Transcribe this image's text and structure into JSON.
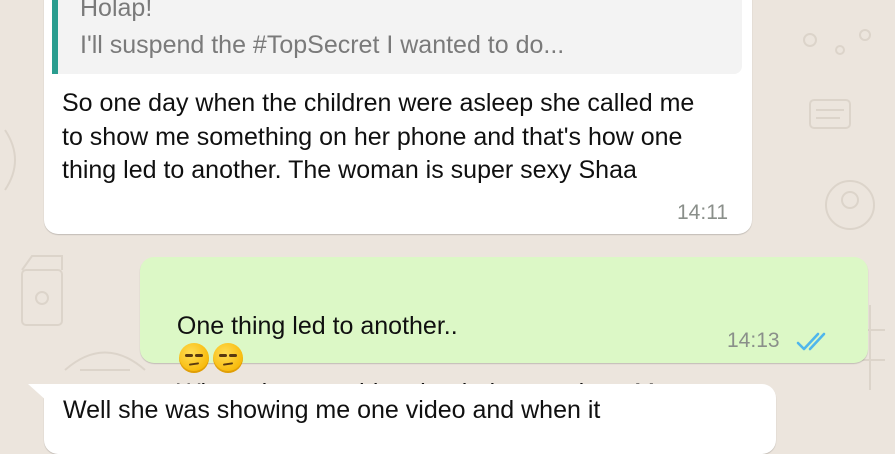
{
  "quoted_message": {
    "author": "Holap!",
    "text": "I'll suspend the #TopSecret I wanted to do..."
  },
  "messages": [
    {
      "direction": "incoming",
      "text": "So one day when the children were asleep she called me to show me something on her phone and that's how one thing led to another. The woman is super sexy Shaa",
      "time": "14:11"
    },
    {
      "direction": "outgoing",
      "text_before_emoji": "One thing led to another..",
      "emoji": "unamused-face-emoji",
      "text_after_emoji": "Whats that one thing that led to another.. M",
      "time": "14:13",
      "status_icon": "double-check-read-icon"
    },
    {
      "direction": "incoming",
      "text": "Well she was showing me one video and when it"
    }
  ],
  "colors": {
    "wallpaper": "#ece5dd",
    "incoming_bubble": "#ffffff",
    "outgoing_bubble": "#dcf8c6",
    "read_ticks": "#4fb6ec",
    "quote_bar": "#2a9d8f"
  }
}
